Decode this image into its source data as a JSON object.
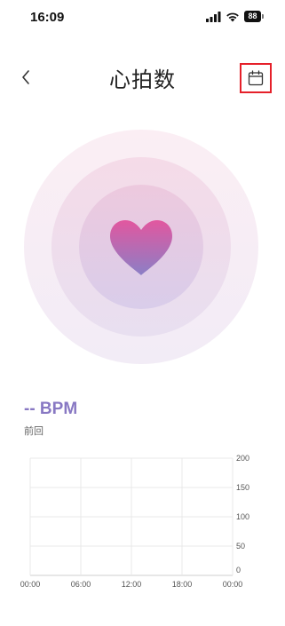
{
  "status_bar": {
    "time": "16:09",
    "battery": "88"
  },
  "header": {
    "title": "心拍数",
    "back_icon": "chevron-left-icon",
    "calendar_icon": "calendar-icon",
    "highlight_color": "#e5202a"
  },
  "heart": {
    "icon": "heart-icon",
    "gradient_top": "#e2579f",
    "gradient_bottom": "#8b7fc6"
  },
  "bpm": {
    "value": "-- BPM",
    "sublabel": "前回",
    "color": "#8878c3"
  },
  "chart_data": {
    "type": "line",
    "x_ticks": [
      "00:00",
      "06:00",
      "12:00",
      "18:00",
      "00:00"
    ],
    "y_ticks": [
      "200",
      "150",
      "100",
      "50",
      "0"
    ],
    "ylim": [
      0,
      200
    ],
    "series": [],
    "grid": true
  }
}
